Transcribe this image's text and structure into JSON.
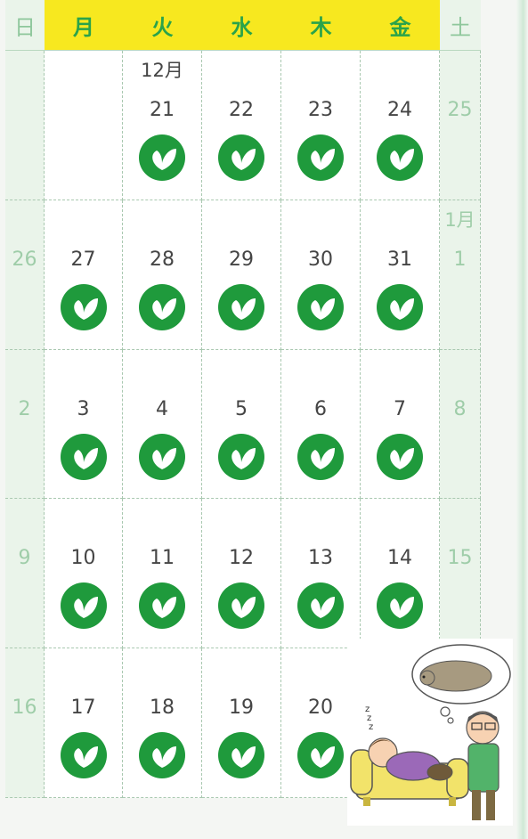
{
  "calendar": {
    "headers": [
      "日",
      "月",
      "火",
      "水",
      "木",
      "金",
      "土"
    ],
    "month_labels": {
      "december": "12月",
      "january": "1月"
    },
    "weeks": [
      [
        "",
        "",
        "21",
        "22",
        "23",
        "24",
        "25"
      ],
      [
        "26",
        "27",
        "28",
        "29",
        "30",
        "31",
        "1"
      ],
      [
        "2",
        "3",
        "4",
        "5",
        "6",
        "7",
        "8"
      ],
      [
        "9",
        "10",
        "11",
        "12",
        "13",
        "14",
        "15"
      ],
      [
        "16",
        "17",
        "18",
        "19",
        "20",
        "",
        ""
      ]
    ],
    "marked_icon": "green-circle-leaf-icon"
  },
  "illustration": {
    "icon": "sleeping-on-sofa-illustration"
  },
  "colors": {
    "weekday_header": "#f7e81f",
    "header_text": "#2aa34a",
    "weekend_bg": "#eaf4ea",
    "weekend_text": "#9fcda9",
    "mark_green": "#1f9a3c",
    "day_text": "#454545",
    "grid_line": "#a9c8b0"
  }
}
